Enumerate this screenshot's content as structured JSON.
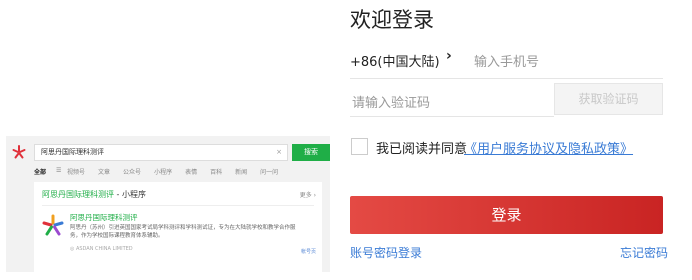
{
  "thumbnail": {
    "search_query": "阿思丹国际理科测评",
    "clear_icon": "×",
    "search_button": "搜索",
    "tabs": [
      "全部",
      "视频号",
      "文章",
      "公众号",
      "小程序",
      "表情",
      "百科",
      "新闻",
      "问一问"
    ],
    "card": {
      "title": "阿思丹国际理科测评",
      "title_suffix": " - 小程序",
      "more": "更多 ›",
      "app_name": "阿思丹国际理科测评",
      "app_desc": "阿思丹（苏州）引进英国国家考试局学科测评和学科测试证，专为在大陆就学校和教学合作服务，作为学校国际课程教育体系辅助。",
      "company": "ASDAN CHINA LIMITED",
      "tag": "帐号页"
    }
  },
  "login": {
    "title": "欢迎登录",
    "country_code": "+86(中国大陆)",
    "arrow": "›",
    "phone_placeholder": "输入手机号",
    "code_placeholder": "请输入验证码",
    "get_code_button": "获取验证码",
    "agree_text": "我已阅读并同意",
    "agree_link": "《用户服务协议及隐私政策》",
    "login_button": "登录",
    "password_login": "账号密码登录",
    "forgot_password": "忘记密码"
  },
  "colors": {
    "accent_green": "#1fae47",
    "login_red": "#d9322f",
    "link_blue": "#3a7bd5"
  }
}
